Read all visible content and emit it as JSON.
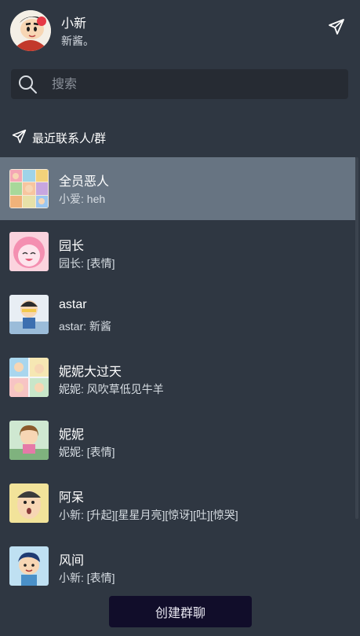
{
  "profile": {
    "name": "小新",
    "signature": "新酱。",
    "avatar_icon": "crayon-shinchan-avatar"
  },
  "header": {
    "send_icon": "paper-plane-icon"
  },
  "search": {
    "placeholder": "搜索",
    "value": ""
  },
  "section": {
    "title": "最近联系人/群",
    "icon": "paper-plane-icon"
  },
  "conversations": [
    {
      "title": "全员恶人",
      "preview": "小爱: heh",
      "active": true,
      "avatar_icon": "group-collage-avatar"
    },
    {
      "title": "园长",
      "preview": "园长: [表情]",
      "active": false,
      "avatar_icon": "pink-character-avatar"
    },
    {
      "title": "astar",
      "preview": "astar: 新酱",
      "active": false,
      "avatar_icon": "astar-avatar"
    },
    {
      "title": "妮妮大过天",
      "preview": "妮妮: 风吹草低见牛羊",
      "active": false,
      "avatar_icon": "group-collage-avatar"
    },
    {
      "title": "妮妮",
      "preview": "妮妮: [表情]",
      "active": false,
      "avatar_icon": "nene-avatar"
    },
    {
      "title": "阿呆",
      "preview": "小新: [升起][星星月亮][惊讶][吐][惊哭]",
      "active": false,
      "avatar_icon": "bo-chan-avatar"
    },
    {
      "title": "风间",
      "preview": "小新: [表情]",
      "active": false,
      "avatar_icon": "kazama-avatar"
    }
  ],
  "actions": {
    "create_group": "创建群聊"
  },
  "colors": {
    "background": "#2f3742",
    "active_item": "#677482",
    "search_bg": "#262b33",
    "button_bg": "#110d2a"
  }
}
